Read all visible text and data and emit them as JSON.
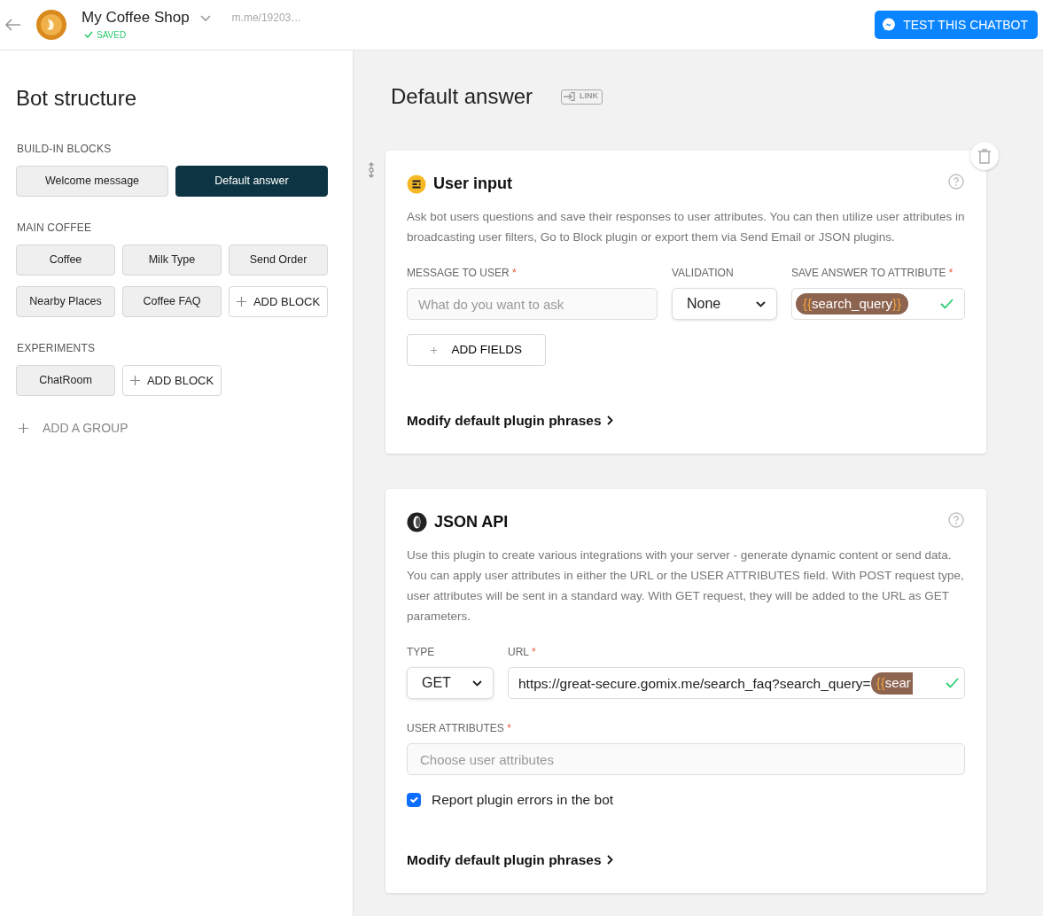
{
  "header": {
    "title": "My Coffee Shop",
    "status": "SAVED",
    "link": "m.me/19203…",
    "test_button": "TEST THIS CHATBOT"
  },
  "sidebar": {
    "title": "Bot structure",
    "groups": [
      {
        "title": "BUILD-IN BLOCKS",
        "blocks": [
          {
            "kind": "block",
            "label": "Welcome message",
            "selected": false
          },
          {
            "kind": "block",
            "label": "Default answer",
            "selected": true
          }
        ]
      },
      {
        "title": "MAIN COFFEE",
        "blocks": [
          {
            "kind": "block",
            "label": "Coffee",
            "selected": false
          },
          {
            "kind": "block",
            "label": "Milk Type",
            "selected": false
          },
          {
            "kind": "block",
            "label": "Send Order",
            "selected": false
          },
          {
            "kind": "block",
            "label": "Nearby Places",
            "selected": false
          },
          {
            "kind": "block",
            "label": "Coffee FAQ",
            "selected": false
          },
          {
            "kind": "add",
            "label": "ADD BLOCK"
          }
        ]
      },
      {
        "title": "EXPERIMENTS",
        "blocks": [
          {
            "kind": "block",
            "label": "ChatRoom",
            "selected": false
          },
          {
            "kind": "add",
            "label": "ADD BLOCK"
          }
        ]
      }
    ],
    "add_group": "ADD A GROUP"
  },
  "main": {
    "title": "Default answer",
    "link_badge": "LINK",
    "plugins": [
      {
        "kind": "user_input",
        "title": "User input",
        "description": "Ask bot users questions and save their responses to user attributes. You can then utilize user attributes in broadcasting user filters, Go to Block plugin or export them via Send Email or JSON plugins.",
        "message_label": "MESSAGE TO USER",
        "message_required": "*",
        "attribute_required": "*",
        "message_placeholder": "What do you want to ask",
        "validation_label": "VALIDATION",
        "validation_value": "None",
        "attribute_label": "SAVE ANSWER TO ATTRIBUTE",
        "attribute_chip": {
          "open": "{{",
          "name": "search_query",
          "close": "}}"
        },
        "add_fields": "ADD FIELDS",
        "phrases_link": "Modify default plugin phrases"
      },
      {
        "kind": "json_api",
        "title": "JSON API",
        "description": "Use this plugin to create various integrations with your server - generate dynamic content or send data. You can apply user attributes in either the URL or the USER ATTRIBUTES field. With POST request type, user attributes will be sent in a standard way. With GET request, they will be added to the URL as GET parameters.",
        "type_label": "TYPE",
        "type_value": "GET",
        "url_label": "URL",
        "url_required": "*",
        "attributes_required": "*",
        "url_value": "https://great-secure.gomix.me/search_faq?search_query=",
        "url_chip": {
          "open": "{{",
          "name": "sear"
        },
        "attributes_label": "USER ATTRIBUTES",
        "attributes_placeholder": "Choose user attributes",
        "report_errors": {
          "label": "Report plugin errors in the bot",
          "checked": true
        },
        "phrases_link": "Modify default plugin phrases"
      }
    ]
  }
}
